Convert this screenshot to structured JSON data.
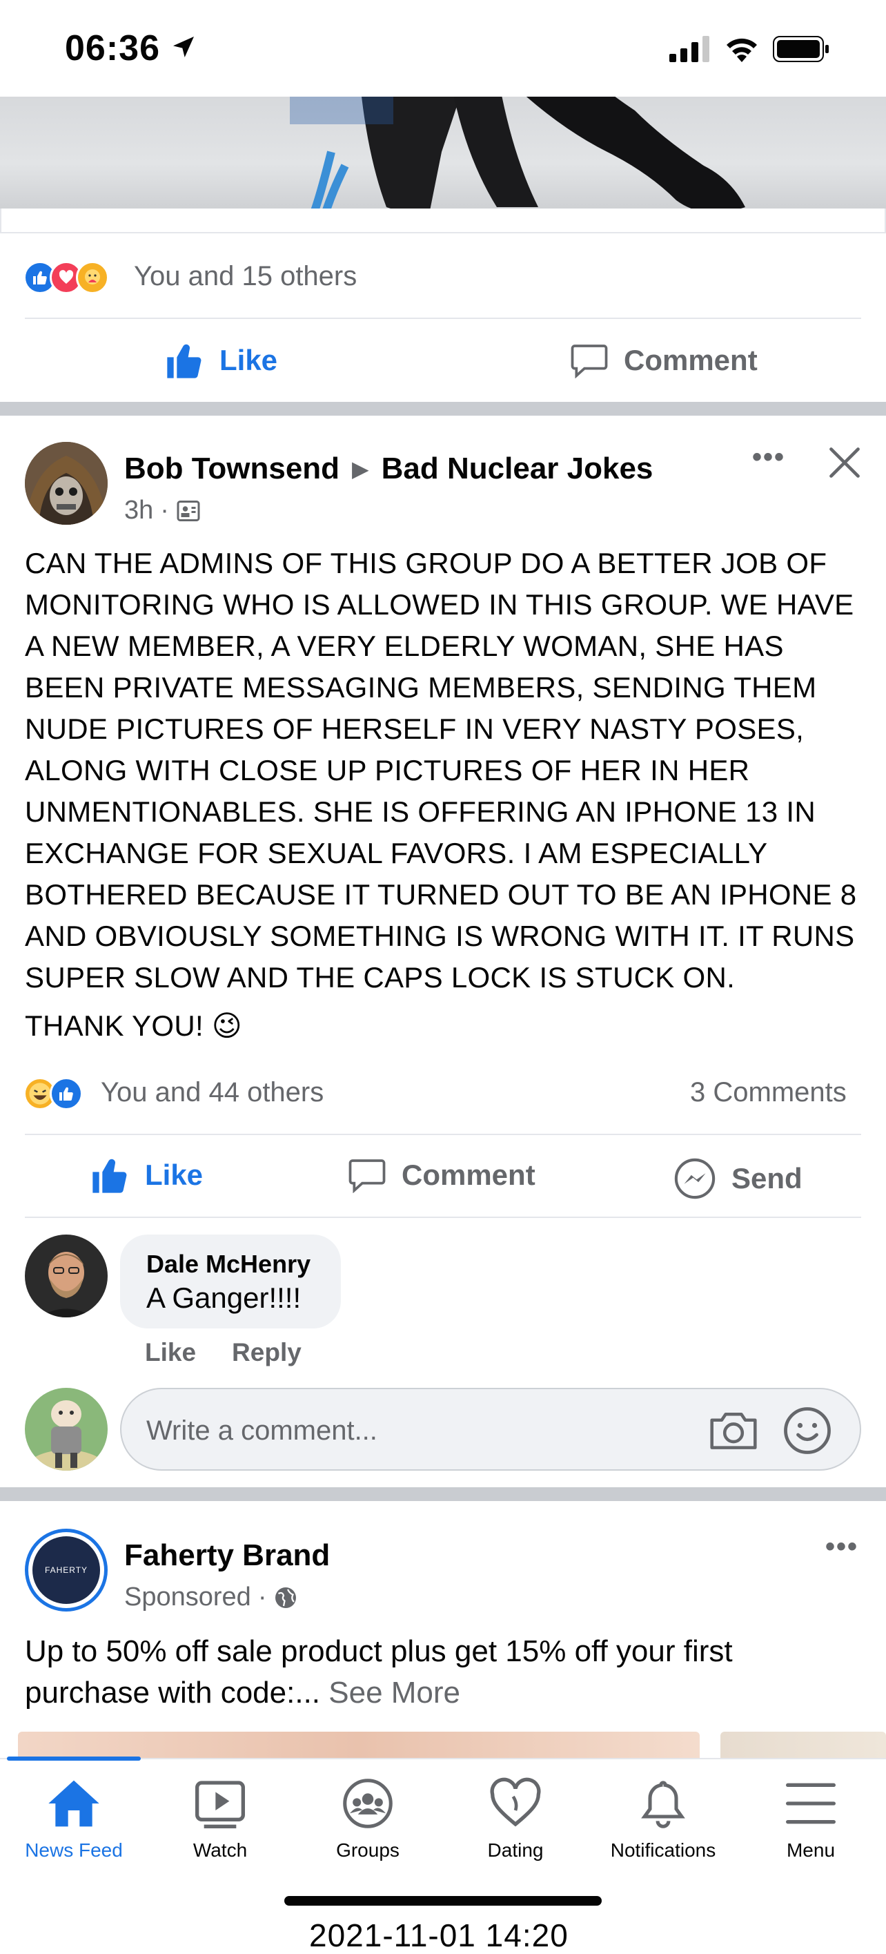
{
  "status_bar": {
    "time": "06:36"
  },
  "previous_post": {
    "reaction_summary": "You and 15 others",
    "like_label": "Like",
    "comment_label": "Comment"
  },
  "post": {
    "author": "Bob Townsend",
    "group": "Bad Nuclear Jokes",
    "time": "3h",
    "body": "CAN THE ADMINS OF THIS GROUP DO A BETTER JOB OF MONITORING WHO IS ALLOWED IN THIS GROUP. WE HAVE A NEW MEMBER, A VERY ELDERLY WOMAN, SHE HAS BEEN PRIVATE MESSAGING MEMBERS, SENDING THEM NUDE PICTURES OF HERSELF IN VERY NASTY POSES, ALONG WITH CLOSE UP PICTURES OF HER IN HER UNMENTIONABLES.  SHE IS OFFERING AN IPHONE 13 IN EXCHANGE FOR SEXUAL FAVORS. I AM ESPECIALLY BOTHERED BECAUSE IT TURNED OUT TO BE AN IPHONE 8 AND OBVIOUSLY SOMETHING IS WRONG WITH IT. IT RUNS SUPER SLOW AND THE CAPS LOCK IS STUCK ON.",
    "sign_off": "THANK YOU! 😉",
    "reaction_summary": "You and 44 others",
    "comment_count": "3 Comments",
    "like_label": "Like",
    "comment_label": "Comment",
    "send_label": "Send",
    "comment": {
      "author": "Dale McHenry",
      "text": "A Ganger!!!!",
      "like_label": "Like",
      "reply_label": "Reply"
    },
    "write_placeholder": "Write a comment..."
  },
  "sponsored": {
    "brand": "Faherty Brand",
    "logo_text": "FAHERTY",
    "label": "Sponsored",
    "text": "Up to 50% off sale product plus get 15% off your first purchase with code:...",
    "see_more": "See More"
  },
  "tabbar": {
    "tabs": [
      {
        "label": "News Feed",
        "icon": "home-icon"
      },
      {
        "label": "Watch",
        "icon": "play-icon"
      },
      {
        "label": "Groups",
        "icon": "groups-icon"
      },
      {
        "label": "Dating",
        "icon": "heart-icon"
      },
      {
        "label": "Notifications",
        "icon": "bell-icon"
      },
      {
        "label": "Menu",
        "icon": "hamburger-icon"
      }
    ]
  },
  "timestamp": "2021-11-01 14:20",
  "colors": {
    "accent": "#1b74e4",
    "muted": "#65676b",
    "separator": "#c9ccd1"
  }
}
